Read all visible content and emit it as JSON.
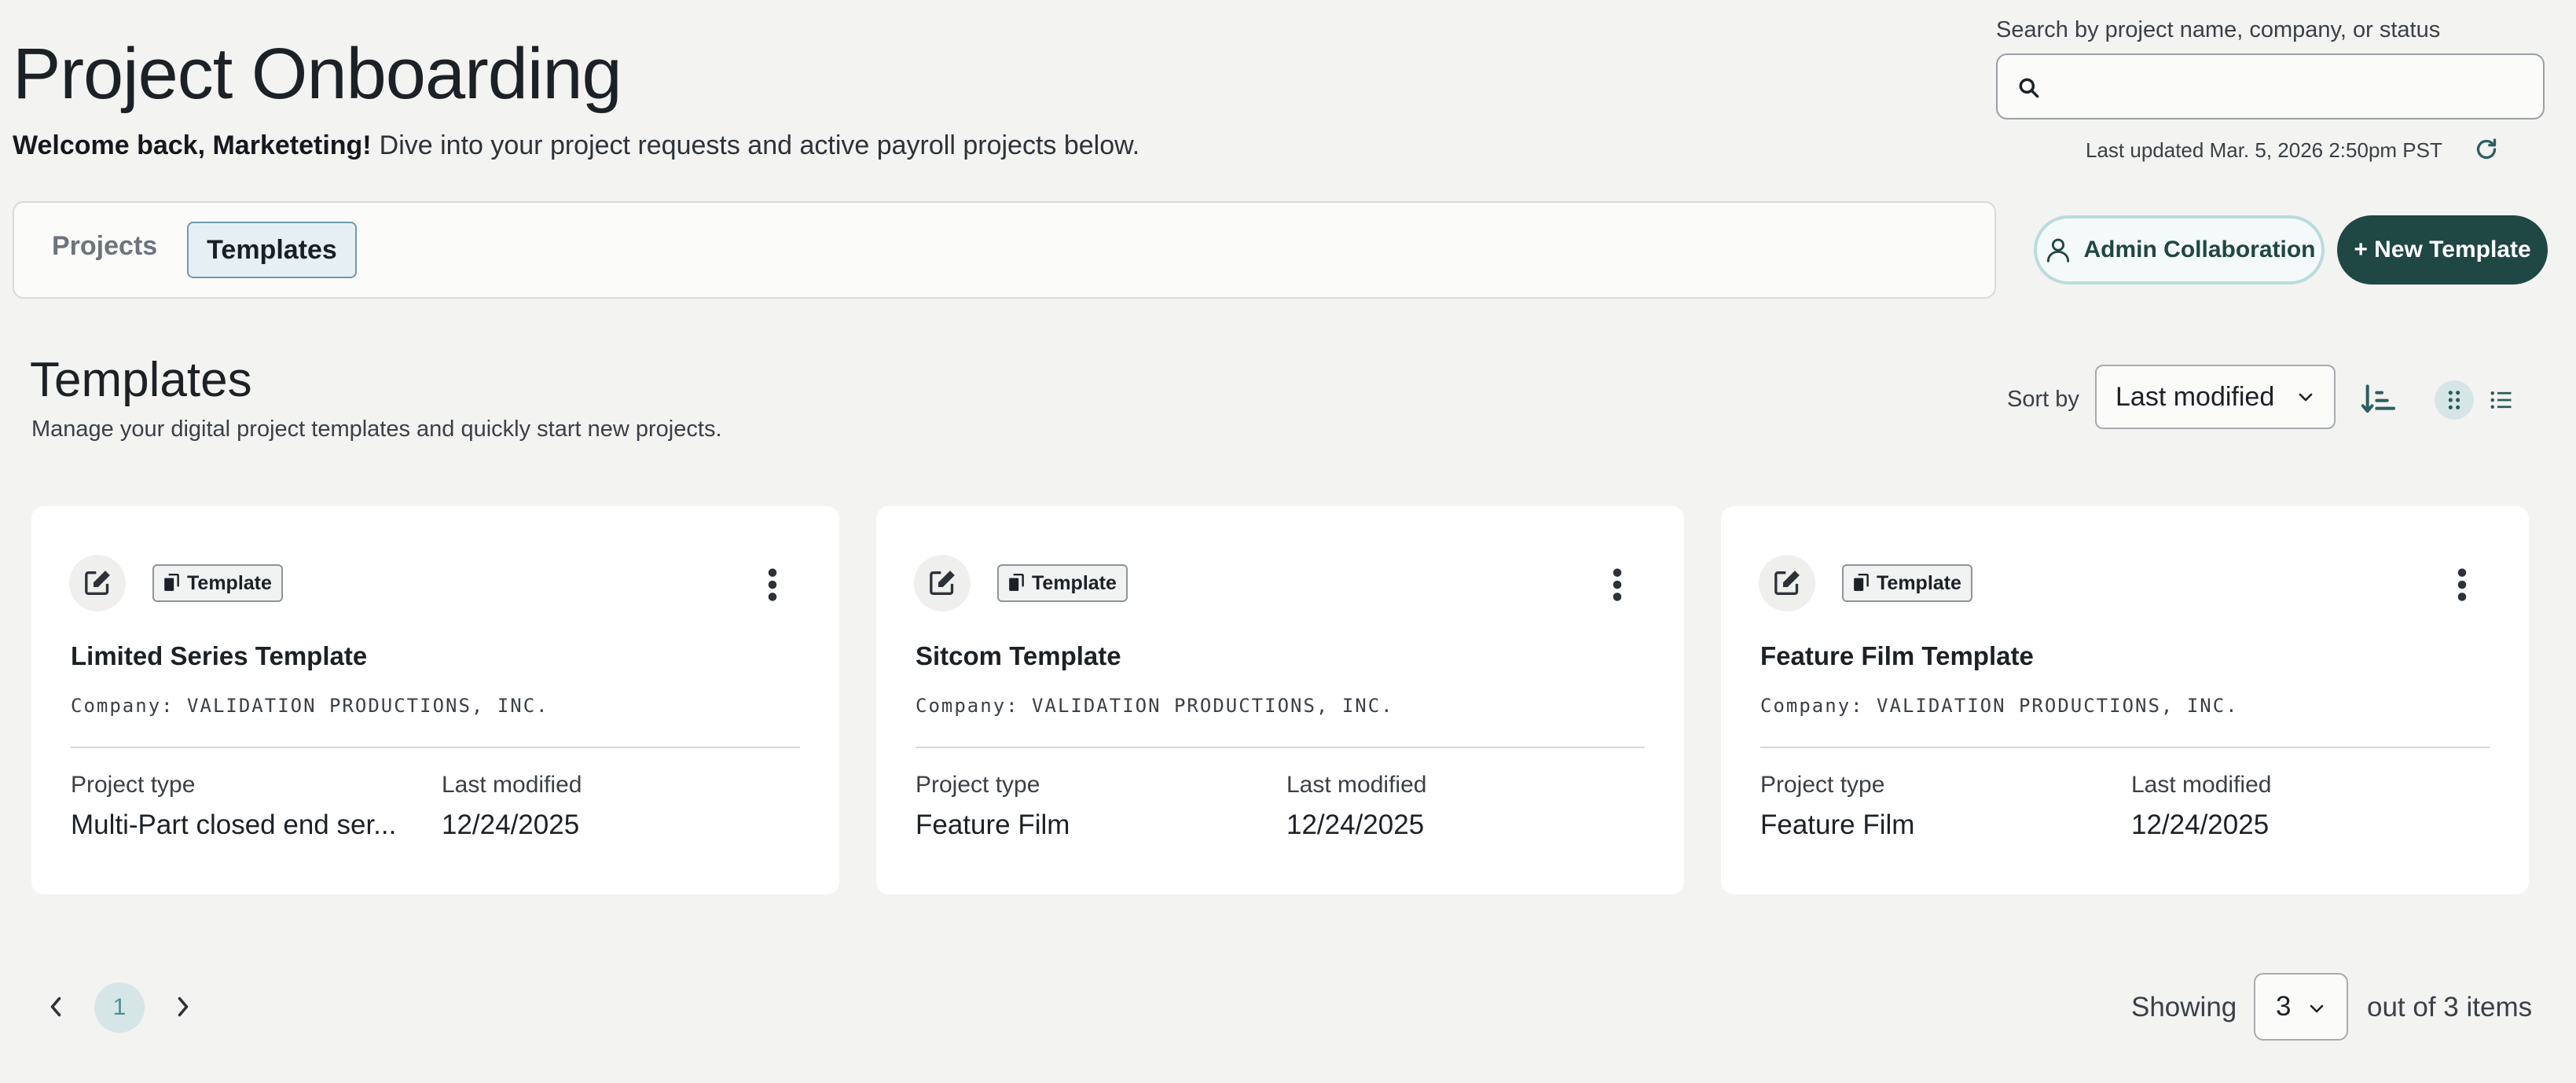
{
  "header": {
    "title": "Project Onboarding",
    "welcome_bold": "Welcome back, Marketeting!",
    "welcome_text": "Dive into your project requests and active payroll projects below."
  },
  "search": {
    "label": "Search by project name, company, or status",
    "value": "",
    "placeholder": ""
  },
  "last_updated": "Last updated Mar. 5, 2026 2:50pm PST",
  "tabs": [
    {
      "label": "Projects",
      "active": false
    },
    {
      "label": "Templates",
      "active": true
    }
  ],
  "actions": {
    "admin_collaboration": "Admin Collaboration",
    "new_template": "+ New Template"
  },
  "section": {
    "title": "Templates",
    "subtitle": "Manage your digital project templates and quickly start new projects."
  },
  "sort": {
    "label": "Sort by",
    "selected": "Last modified"
  },
  "cards": [
    {
      "badge": "Template",
      "name": "Limited Series Template",
      "company": "Company: VALIDATION PRODUCTIONS, INC.",
      "project_type_label": "Project type",
      "project_type": "Multi-Part closed end ser...",
      "last_modified_label": "Last modified",
      "last_modified": "12/24/2025"
    },
    {
      "badge": "Template",
      "name": "Sitcom Template",
      "company": "Company: VALIDATION PRODUCTIONS, INC.",
      "project_type_label": "Project type",
      "project_type": "Feature Film",
      "last_modified_label": "Last modified",
      "last_modified": "12/24/2025"
    },
    {
      "badge": "Template",
      "name": "Feature Film Template",
      "company": "Company: VALIDATION PRODUCTIONS, INC.",
      "project_type_label": "Project type",
      "project_type": "Feature Film",
      "last_modified_label": "Last modified",
      "last_modified": "12/24/2025"
    }
  ],
  "pagination": {
    "current_page": "1",
    "showing_label": "Showing",
    "page_size": "3",
    "out_of": "out of 3 items"
  },
  "colors": {
    "primary": "#1f4744",
    "accent_light": "#d6e6e6",
    "background": "#f3f3f1"
  }
}
